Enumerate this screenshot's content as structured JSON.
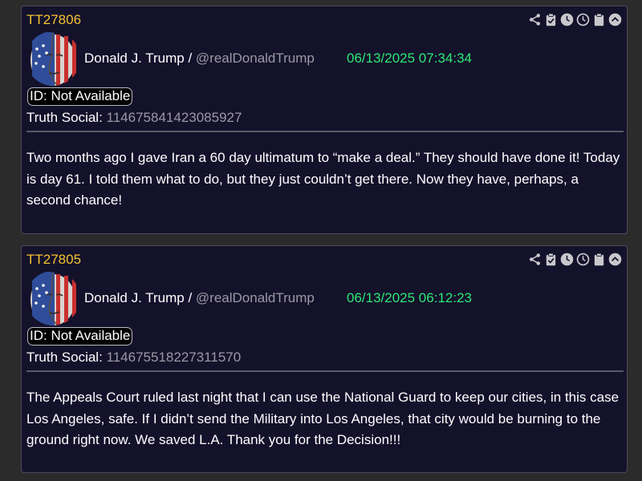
{
  "posts": [
    {
      "post_id": "TT27806",
      "author_name": "Donald J. Trump",
      "separator": " / ",
      "handle": "@realDonaldTrump",
      "timestamp": "06/13/2025 07:34:34",
      "id_label": "ID: Not Available",
      "truth_social_label": "Truth Social: ",
      "truth_social_id": "114675841423085927",
      "text": "Two months ago I gave Iran a 60 day ultimatum to “make a deal.” They should have done it! Today is day 61. I told them what to do, but they just couldn’t get there. Now they have, perhaps, a second chance!"
    },
    {
      "post_id": "TT27805",
      "author_name": "Donald J. Trump",
      "separator": " / ",
      "handle": "@realDonaldTrump",
      "timestamp": "06/13/2025 06:12:23",
      "id_label": "ID: Not Available",
      "truth_social_label": "Truth Social: ",
      "truth_social_id": "114675518227311570",
      "text": "The Appeals Court ruled last night that I can use the National Guard to keep our cities, in this case Los Angeles, safe. If I didn’t send the Military into Los Angeles, that city would be burning to the ground right now. We saved L.A. Thank you for the Decision!!!"
    }
  ],
  "toolbar_icons": [
    "share-icon",
    "clipboard-check-icon",
    "clock-filled-icon",
    "clock-outline-icon",
    "clipboard-icon",
    "chevron-up-circle-icon"
  ],
  "colors": {
    "post_id": "#f2c230",
    "timestamp": "#2ee875",
    "card_background": "#14112b",
    "muted_text": "#9a99a4",
    "icon": "#c8c8cc"
  }
}
